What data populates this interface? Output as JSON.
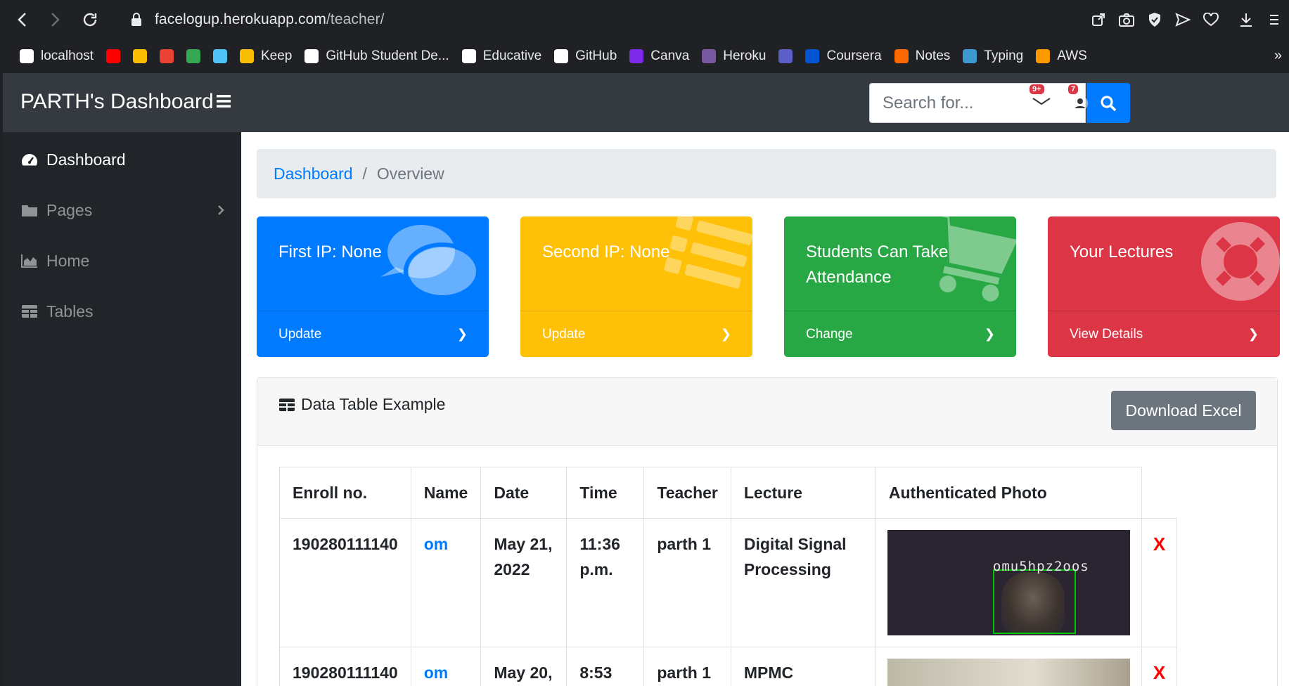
{
  "browser": {
    "url_host": "facelogup.herokuapp.com",
    "url_path": "/teacher/",
    "bookmarks": [
      {
        "label": "localhost",
        "color": "#ffffff"
      },
      {
        "label": "",
        "color": "#ff0000"
      },
      {
        "label": "",
        "color": "#fbbc04"
      },
      {
        "label": "",
        "color": "#ea4335"
      },
      {
        "label": "",
        "color": "#34a853"
      },
      {
        "label": "",
        "color": "#4fc3f7"
      },
      {
        "label": "Keep",
        "color": "#fbbc04"
      },
      {
        "label": "GitHub Student De...",
        "color": "#ffffff"
      },
      {
        "label": "Educative",
        "color": "#ffffff"
      },
      {
        "label": "GitHub",
        "color": "#ffffff"
      },
      {
        "label": "Canva",
        "color": "#7d2ae8"
      },
      {
        "label": "Heroku",
        "color": "#79589f"
      },
      {
        "label": "",
        "color": "#5b5fc7"
      },
      {
        "label": "Coursera",
        "color": "#0056d2"
      },
      {
        "label": "Notes",
        "color": "#ff6900"
      },
      {
        "label": "Typing",
        "color": "#3d9ad1"
      },
      {
        "label": "AWS",
        "color": "#ff9900"
      }
    ]
  },
  "topnav": {
    "brand": "PARTH's Dashboard",
    "search_placeholder": "Search for...",
    "alerts_badge": "9+",
    "messages_badge": "7"
  },
  "sidebar": {
    "items": [
      {
        "label": "Dashboard",
        "icon": "tachometer-icon",
        "active": true
      },
      {
        "label": "Pages",
        "icon": "folder-icon",
        "active": false
      },
      {
        "label": "Home",
        "icon": "area-chart-icon",
        "active": false
      },
      {
        "label": "Tables",
        "icon": "table-icon",
        "active": false
      }
    ]
  },
  "breadcrumb": {
    "link": "Dashboard",
    "separator": "/",
    "current": "Overview"
  },
  "cards": [
    {
      "title": "First IP: None",
      "action": "Update",
      "color": "#007bff",
      "icon": "comments-icon"
    },
    {
      "title": "Second IP: None",
      "action": "Update",
      "color": "#ffc107",
      "icon": "list-icon"
    },
    {
      "title": "Students Can Take Attendance",
      "action": "Change",
      "color": "#28a745",
      "icon": "shopping-cart-icon"
    },
    {
      "title": "Your Lectures",
      "action": "View Details",
      "color": "#dc3545",
      "icon": "life-ring-icon"
    }
  ],
  "table": {
    "title": "Data Table Example",
    "download_label": "Download Excel",
    "columns": [
      "Enroll no.",
      "Name",
      "Date",
      "Time",
      "Teacher",
      "Lecture",
      "Authenticated Photo"
    ],
    "rows": [
      {
        "enroll": "190280111140",
        "name": "om",
        "date": "May 21, 2022",
        "time": "11:36 p.m.",
        "teacher": "parth 1",
        "lecture": "Digital Signal Processing",
        "photo_text": "omu5hpz2oos",
        "delete": "X"
      },
      {
        "enroll": "190280111140",
        "name": "om",
        "date": "May 20,",
        "time": "8:53",
        "teacher": "parth 1",
        "lecture": "MPMC",
        "photo_text": "",
        "delete": "X"
      }
    ]
  }
}
